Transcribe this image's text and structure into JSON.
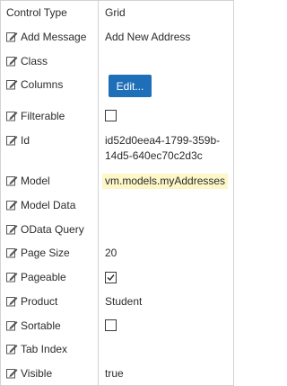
{
  "rows": {
    "control_type": {
      "label": "Control Type",
      "value": "Grid"
    },
    "add_message": {
      "label": "Add Message",
      "value": "Add New Address"
    },
    "class": {
      "label": "Class",
      "value": ""
    },
    "columns": {
      "label": "Columns",
      "button_label": "Edit..."
    },
    "filterable": {
      "label": "Filterable",
      "checked": false
    },
    "id": {
      "label": "Id",
      "value_line1": "id52d0eea4-1799-359b-",
      "value_line2": "14d5-640ec70c2d3c"
    },
    "model": {
      "label": "Model",
      "value": "vm.models.myAddresses"
    },
    "model_data": {
      "label": "Model Data",
      "value": ""
    },
    "odata_query": {
      "label": "OData Query",
      "value": ""
    },
    "page_size": {
      "label": "Page Size",
      "value": "20"
    },
    "pageable": {
      "label": "Pageable",
      "checked": true
    },
    "product": {
      "label": "Product",
      "value": "Student"
    },
    "sortable": {
      "label": "Sortable",
      "checked": false
    },
    "tab_index": {
      "label": "Tab Index",
      "value": ""
    },
    "visible": {
      "label": "Visible",
      "value": "true"
    }
  },
  "icons": {
    "edit": "pencil-edit-icon"
  },
  "colors": {
    "button": "#1f6fb8",
    "highlight": "#fdf7c8",
    "border": "#d3d3d3"
  }
}
